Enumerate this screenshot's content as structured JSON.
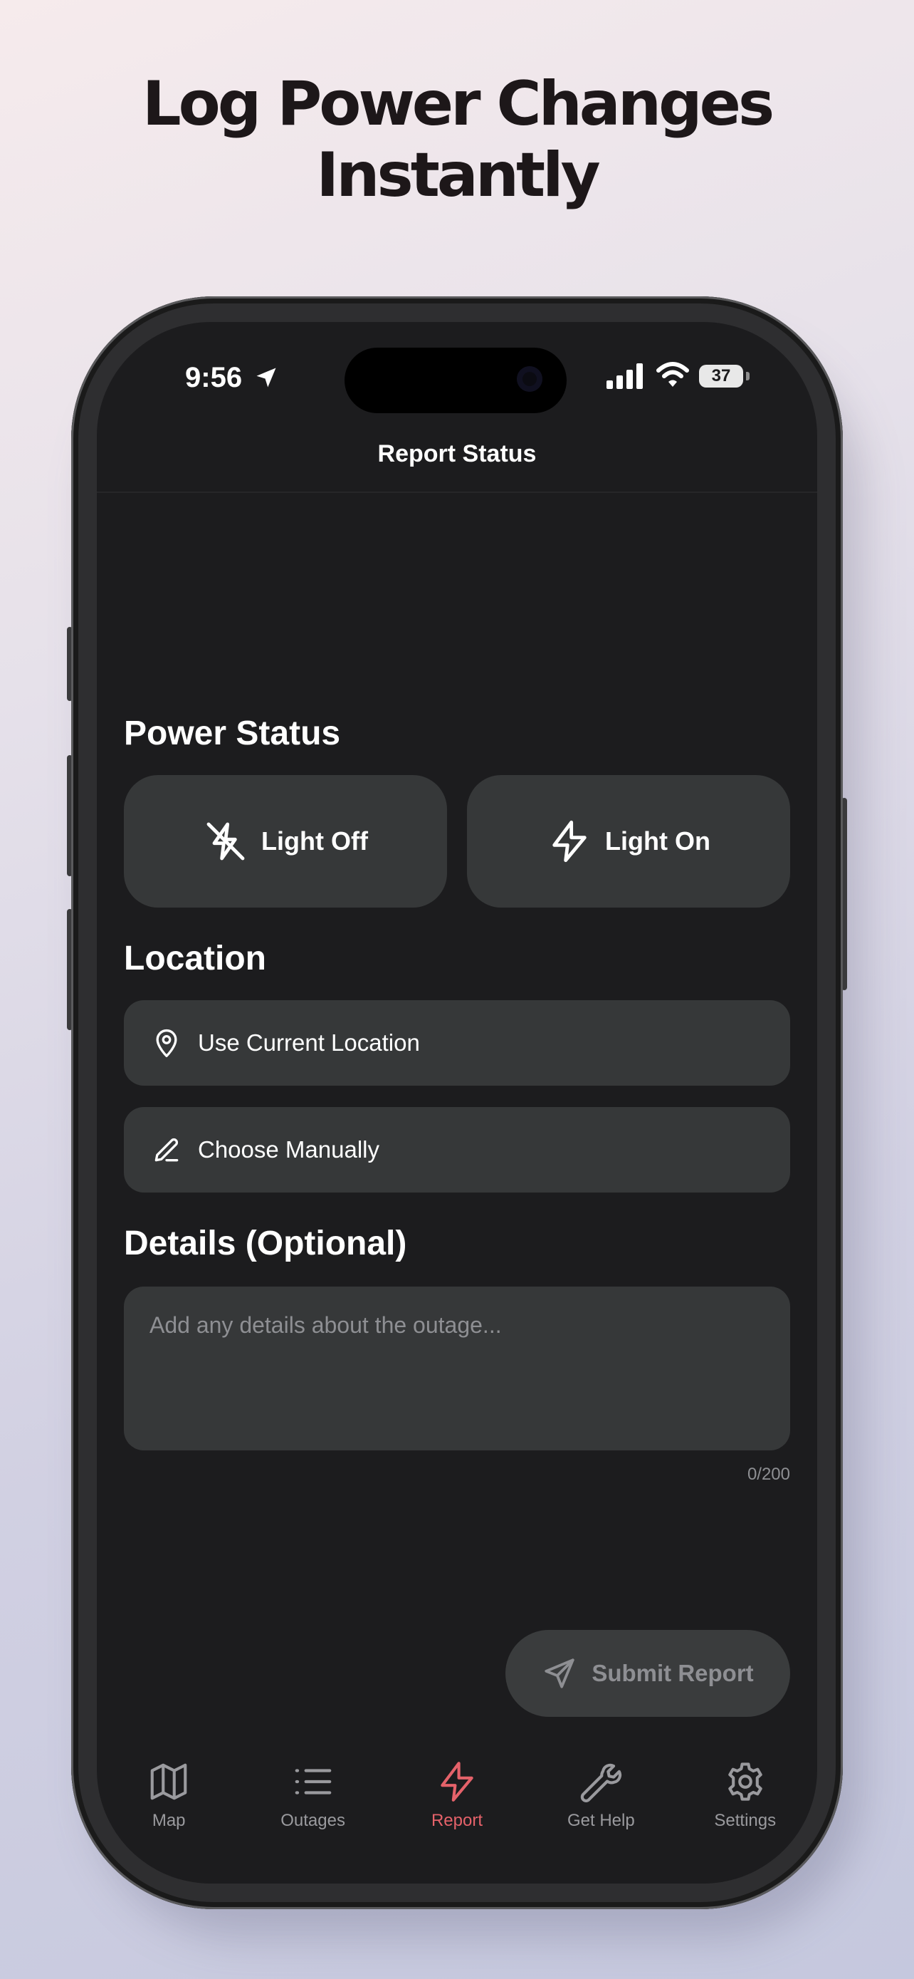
{
  "headline": {
    "line1": "Log Power Changes",
    "line2": "Instantly"
  },
  "status_bar": {
    "time": "9:56",
    "battery": "37"
  },
  "nav": {
    "title": "Report Status"
  },
  "power_status": {
    "title": "Power Status",
    "light_off_label": "Light Off",
    "light_on_label": "Light On"
  },
  "location": {
    "title": "Location",
    "current_label": "Use Current Location",
    "manual_label": "Choose Manually"
  },
  "details": {
    "title": "Details (Optional)",
    "placeholder": "Add any details about the outage...",
    "counter": "0/200"
  },
  "submit": {
    "label": "Submit Report"
  },
  "tabs": [
    {
      "label": "Map",
      "icon": "map-icon"
    },
    {
      "label": "Outages",
      "icon": "list-icon"
    },
    {
      "label": "Report",
      "icon": "bolt-icon",
      "active": true
    },
    {
      "label": "Get Help",
      "icon": "wrench-icon"
    },
    {
      "label": "Settings",
      "icon": "gear-icon"
    }
  ],
  "colors": {
    "accent": "#e5626a",
    "screen_bg": "#1c1c1e",
    "card_bg": "#363839"
  }
}
